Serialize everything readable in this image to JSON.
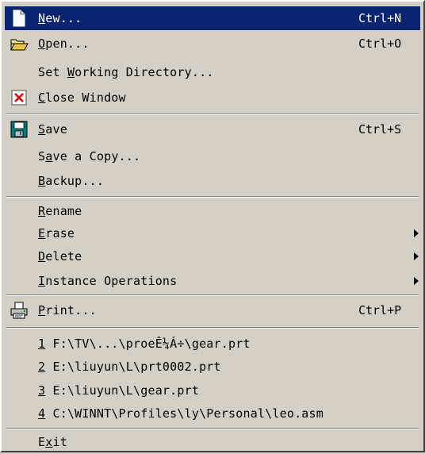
{
  "menu": {
    "items": [
      {
        "mn": "N",
        "rest": "ew...",
        "shortcut": "Ctrl+N",
        "icon": "new-document-icon"
      },
      {
        "mn": "O",
        "rest": "pen...",
        "shortcut": "Ctrl+O",
        "icon": "open-folder-icon"
      },
      {
        "pre": "Set ",
        "mn": "W",
        "rest": "orking Directory..."
      },
      {
        "mn": "C",
        "rest": "lose Window",
        "icon": "close-window-icon"
      },
      {
        "mn": "S",
        "rest": "ave",
        "shortcut": "Ctrl+S",
        "icon": "save-disk-icon"
      },
      {
        "pre": "S",
        "mn": "a",
        "rest": "ve a Copy..."
      },
      {
        "mn": "B",
        "rest": "ackup..."
      },
      {
        "mn": "R",
        "rest": "ename"
      },
      {
        "mn": "E",
        "rest": "rase"
      },
      {
        "mn": "D",
        "rest": "elete"
      },
      {
        "mn": "I",
        "rest": "nstance Operations"
      },
      {
        "mn": "P",
        "rest": "rint...",
        "shortcut": "Ctrl+P",
        "icon": "printer-icon"
      },
      {
        "mn": "1",
        "rest": " F:\\TV\\...\\proeÊ¼Á÷\\gear.prt"
      },
      {
        "mn": "2",
        "rest": " E:\\liuyun\\L\\prt0002.prt"
      },
      {
        "mn": "3",
        "rest": " E:\\liuyun\\L\\gear.prt"
      },
      {
        "mn": "4",
        "rest": " C:\\WINNT\\Profiles\\ly\\Personal\\leo.asm"
      },
      {
        "pre": "E",
        "mn": "x",
        "rest": "it"
      }
    ],
    "colors": {
      "face": "#d4d0c8",
      "highlight": "#0a2470",
      "highlight_text": "#ffffff"
    }
  }
}
